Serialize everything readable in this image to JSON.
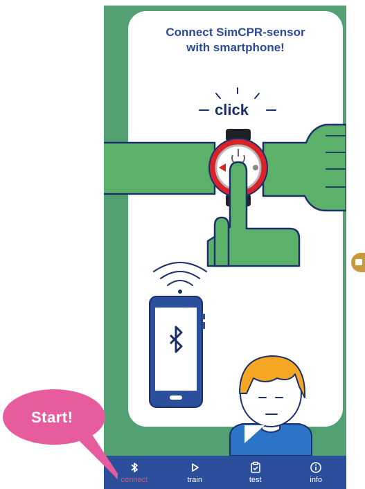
{
  "instruction": {
    "line1": "Connect SimCPR-sensor",
    "line2": "with smartphone!"
  },
  "illustration": {
    "click_label": "click"
  },
  "navbar": {
    "items": [
      {
        "label": "connect",
        "icon": "bluetooth-icon",
        "active": true
      },
      {
        "label": "train",
        "icon": "play-icon",
        "active": false
      },
      {
        "label": "test",
        "icon": "clipboard-check-icon",
        "active": false
      },
      {
        "label": "info",
        "icon": "info-icon",
        "active": false
      }
    ]
  },
  "callout": {
    "label": "Start!"
  },
  "colors": {
    "background_green": "#52a072",
    "hand_green": "#5bb06a",
    "navbar_blue": "#2b4f9b",
    "active_pink": "#ee4f6b",
    "callout_pink": "#e75c9d",
    "heading_blue": "#2b4a93"
  }
}
